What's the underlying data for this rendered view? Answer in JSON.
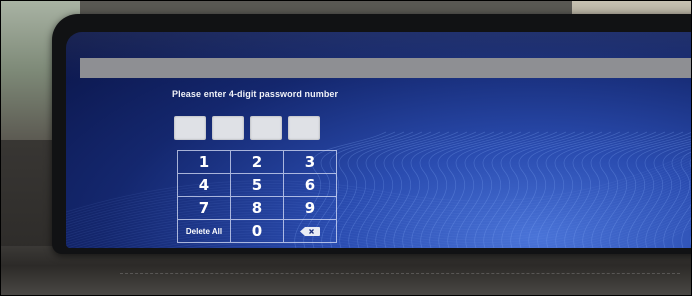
{
  "screen": {
    "prompt": "Please enter 4-digit password number",
    "pin": {
      "digits_entered": 0,
      "slots": [
        "",
        "",
        "",
        ""
      ]
    },
    "keypad": {
      "keys": [
        "1",
        "2",
        "3",
        "4",
        "5",
        "6",
        "7",
        "8",
        "9",
        "Delete All",
        "0",
        "⌫"
      ]
    }
  },
  "colors": {
    "screen_bg": "#14276e",
    "title_bar": "#8e8f93",
    "pin_box": "#dfe1e6",
    "key_text": "#ffffff"
  },
  "icons": {
    "backspace": "backspace-icon"
  }
}
